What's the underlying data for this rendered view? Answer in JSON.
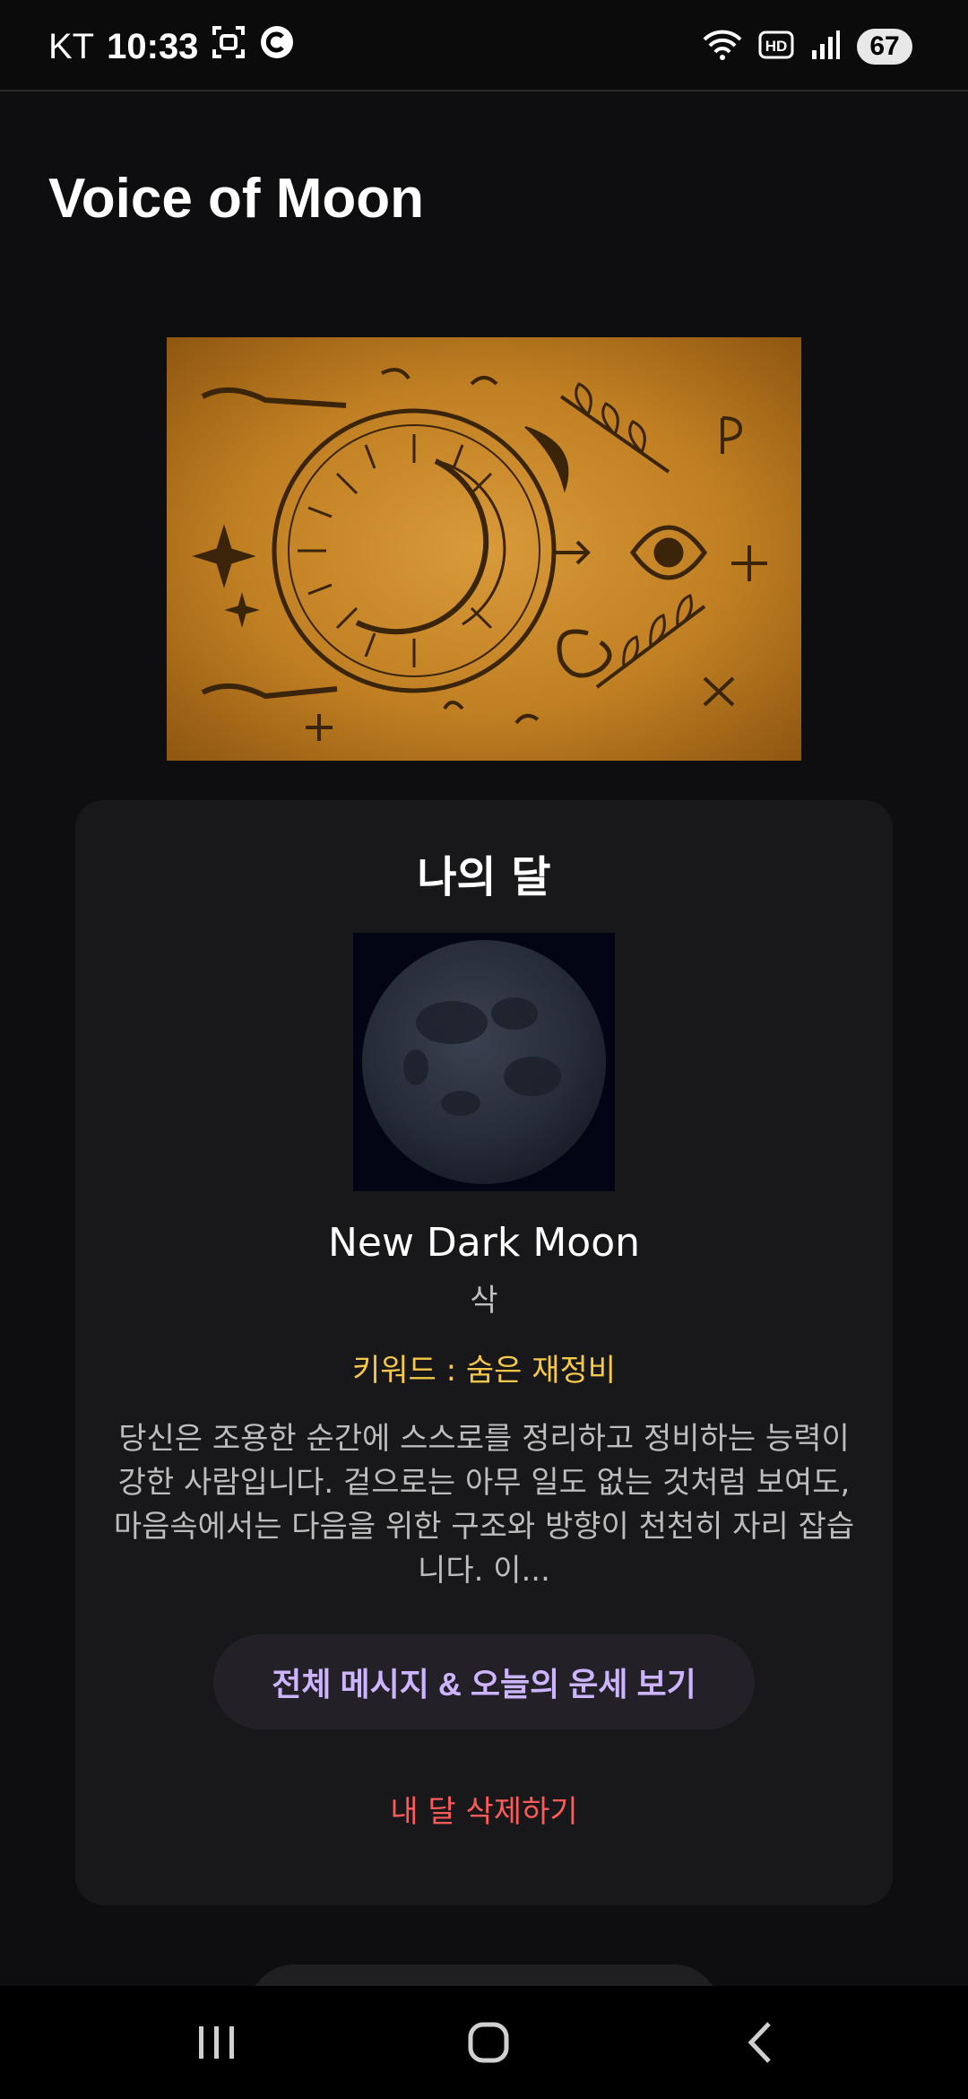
{
  "status_bar": {
    "carrier": "KT",
    "time": "10:33",
    "battery": "67"
  },
  "app": {
    "title": "Voice of Moon"
  },
  "card": {
    "title": "나의 달",
    "moon_name": "New Dark Moon",
    "moon_korean": "삭",
    "keyword": "키워드 : 숨은 재정비",
    "description": "당신은 조용한 순간에 스스로를 정리하고 정비하는 능력이 강한 사람입니다. 겉으로는 아무 일도 없는 것처럼 보여도, 마음속에서는 다음을 위한 구조와 방향이 천천히 자리 잡습니다. 이...",
    "full_message_button": "전체 메시지 & 오늘의 운세 보기",
    "delete_link": "내 달 삭제하기"
  },
  "colors": {
    "background": "#0e0e10",
    "card": "#18181a",
    "keyword": "#f4c84a",
    "button_text": "#cdb4ff",
    "delete": "#ff5a5a"
  },
  "icons": {
    "status": [
      "screenshot-icon",
      "c-icon",
      "wifi-icon",
      "hd-icon",
      "signal-icon",
      "battery-icon"
    ],
    "nav": [
      "recents-icon",
      "home-icon",
      "back-icon"
    ]
  }
}
